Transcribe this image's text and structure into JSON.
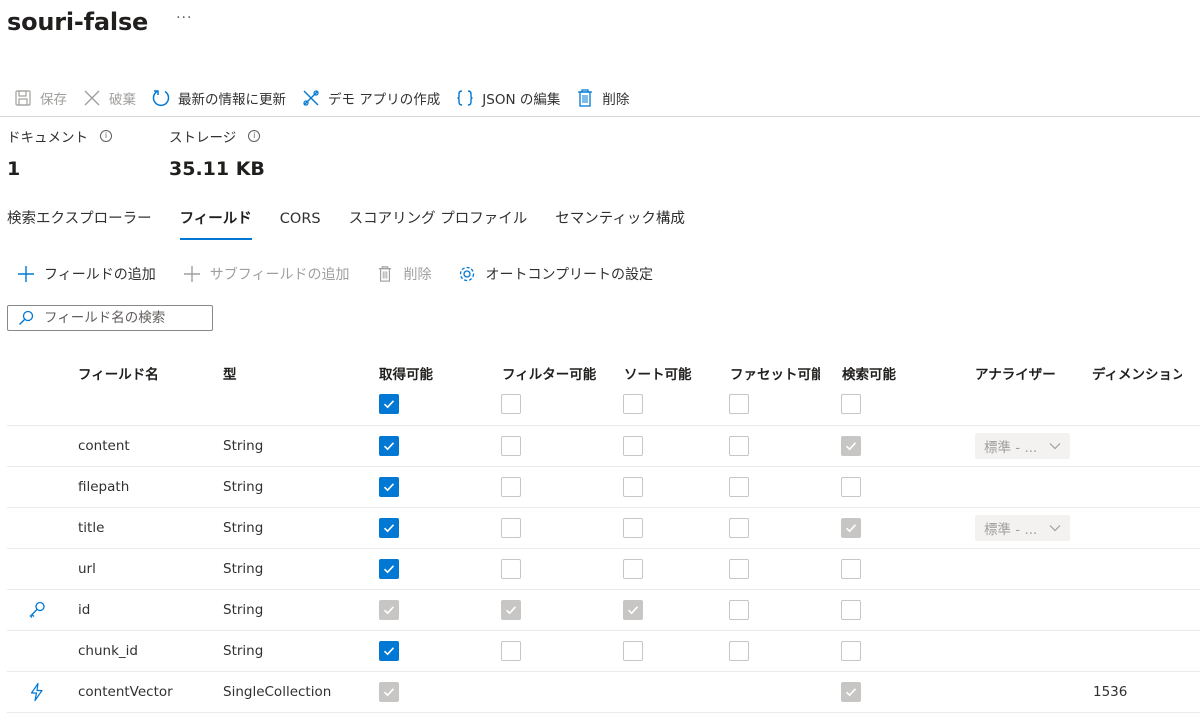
{
  "page": {
    "title": "souri-false",
    "more": "···"
  },
  "toolbar": {
    "items": [
      {
        "name": "save-button",
        "icon": "save-icon",
        "label": "保存",
        "disabled": true
      },
      {
        "name": "discard-button",
        "icon": "close-icon",
        "label": "破棄",
        "disabled": true
      },
      {
        "name": "refresh-button",
        "icon": "refresh-icon",
        "label": "最新の情報に更新",
        "disabled": false
      },
      {
        "name": "create-demo-app-button",
        "icon": "demo-app-icon",
        "label": "デモ アプリの作成",
        "disabled": false
      },
      {
        "name": "edit-json-button",
        "icon": "braces-icon",
        "label": "JSON の編集",
        "disabled": false
      },
      {
        "name": "delete-button",
        "icon": "trash-icon",
        "label": "削除",
        "disabled": false
      }
    ]
  },
  "stats": {
    "documents": {
      "label": "ドキュメント",
      "value": "1"
    },
    "storage": {
      "label": "ストレージ",
      "value": "35.11 KB"
    }
  },
  "tabs": [
    {
      "label": "検索エクスプローラー",
      "active": false
    },
    {
      "label": "フィールド",
      "active": true
    },
    {
      "label": "CORS",
      "active": false
    },
    {
      "label": "スコアリング プロファイル",
      "active": false
    },
    {
      "label": "セマンティック構成",
      "active": false
    }
  ],
  "subtoolbar": {
    "add_field": "フィールドの追加",
    "add_subfield": "サブフィールドの追加",
    "delete": "削除",
    "autocomplete": "オートコンプリートの設定"
  },
  "search": {
    "placeholder": "フィールド名の検索",
    "value": ""
  },
  "columns": {
    "name": "フィールド名",
    "type": "型",
    "retrievable": "取得可能",
    "filterable": "フィルター可能",
    "sortable": "ソート可能",
    "facetable": "ファセット可能",
    "searchable": "検索可能",
    "analyzer": "アナライザー",
    "dimensions": "ディメンション"
  },
  "select_all": {
    "retrievable": "on",
    "filterable": "off",
    "sortable": "off",
    "facetable": "off",
    "searchable": "off"
  },
  "fields": [
    {
      "icon": "",
      "name": "content",
      "type": "String",
      "retrievable": "on",
      "filterable": "off",
      "sortable": "off",
      "facetable": "off",
      "searchable": "on-disabled",
      "analyzer": "標準 - ...",
      "dimensions": ""
    },
    {
      "icon": "",
      "name": "filepath",
      "type": "String",
      "retrievable": "on",
      "filterable": "off",
      "sortable": "off",
      "facetable": "off",
      "searchable": "off",
      "analyzer": "",
      "dimensions": ""
    },
    {
      "icon": "",
      "name": "title",
      "type": "String",
      "retrievable": "on",
      "filterable": "off",
      "sortable": "off",
      "facetable": "off",
      "searchable": "on-disabled",
      "analyzer": "標準 - ...",
      "dimensions": ""
    },
    {
      "icon": "",
      "name": "url",
      "type": "String",
      "retrievable": "on",
      "filterable": "off",
      "sortable": "off",
      "facetable": "off",
      "searchable": "off",
      "analyzer": "",
      "dimensions": ""
    },
    {
      "icon": "key-icon",
      "name": "id",
      "type": "String",
      "retrievable": "on-disabled",
      "filterable": "on-disabled",
      "sortable": "on-disabled",
      "facetable": "off",
      "searchable": "off",
      "analyzer": "",
      "dimensions": ""
    },
    {
      "icon": "",
      "name": "chunk_id",
      "type": "String",
      "retrievable": "on",
      "filterable": "off",
      "sortable": "off",
      "facetable": "off",
      "searchable": "off",
      "analyzer": "",
      "dimensions": ""
    },
    {
      "icon": "vector-bolt-icon",
      "name": "contentVector",
      "type": "SingleCollection",
      "retrievable": "on-disabled",
      "filterable": "none",
      "sortable": "none",
      "facetable": "none",
      "searchable": "on-disabled",
      "analyzer": "",
      "dimensions": "1536"
    }
  ],
  "colors": {
    "accent": "#0078d4",
    "disabled_check": "#c8c6c4"
  }
}
